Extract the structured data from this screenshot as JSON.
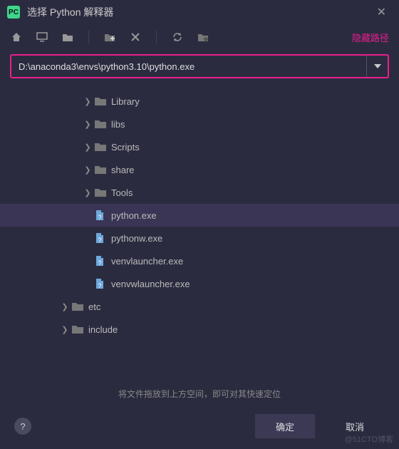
{
  "titlebar": {
    "app_icon_text": "PC",
    "title": "选择 Python 解释器"
  },
  "toolbar": {
    "hide_path": "隐藏路径"
  },
  "path": {
    "value": "D:\\anaconda3\\envs\\python3.10\\python.exe"
  },
  "tree": [
    {
      "indent": 3,
      "kind": "folder",
      "expand": "right",
      "label": "Library",
      "selected": false
    },
    {
      "indent": 3,
      "kind": "folder",
      "expand": "right",
      "label": "libs",
      "selected": false
    },
    {
      "indent": 3,
      "kind": "folder",
      "expand": "right",
      "label": "Scripts",
      "selected": false
    },
    {
      "indent": 3,
      "kind": "folder",
      "expand": "right",
      "label": "share",
      "selected": false
    },
    {
      "indent": 3,
      "kind": "folder",
      "expand": "right",
      "label": "Tools",
      "selected": false
    },
    {
      "indent": 3,
      "kind": "file",
      "expand": "none",
      "label": "python.exe",
      "selected": true
    },
    {
      "indent": 3,
      "kind": "file",
      "expand": "none",
      "label": "pythonw.exe",
      "selected": false
    },
    {
      "indent": 3,
      "kind": "file",
      "expand": "none",
      "label": "venvlauncher.exe",
      "selected": false
    },
    {
      "indent": 3,
      "kind": "file",
      "expand": "none",
      "label": "venvwlauncher.exe",
      "selected": false
    },
    {
      "indent": 2,
      "kind": "folder",
      "expand": "right",
      "label": "etc",
      "selected": false
    },
    {
      "indent": 2,
      "kind": "folder",
      "expand": "right",
      "label": "include",
      "selected": false
    }
  ],
  "hint": "将文件拖放到上方空间，即可对其快速定位",
  "buttons": {
    "ok": "确定",
    "cancel": "取消"
  },
  "watermark": "@51CTO博客"
}
